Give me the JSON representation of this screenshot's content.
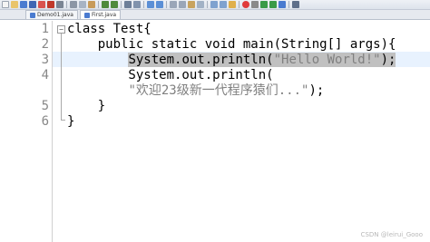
{
  "toolbar": {
    "icons": [
      "new-file-icon",
      "open-icon",
      "save-icon",
      "save-all-icon",
      "close-icon",
      "close-all-icon",
      "print-icon",
      "cut-icon",
      "copy-icon",
      "paste-icon",
      "undo-icon",
      "redo-icon",
      "find-icon",
      "replace-icon",
      "zoom-in-icon",
      "zoom-out-icon",
      "sync-icon",
      "wrap-icon",
      "indent-guide-icon",
      "show-all-icon",
      "doc-map-icon",
      "func-list-icon",
      "folder-icon",
      "record-icon",
      "stop-icon",
      "play-icon",
      "play-multiple-icon",
      "save-macro-icon",
      "spellcheck-icon"
    ]
  },
  "tabs": [
    {
      "label": "Demo01.java",
      "active": false
    },
    {
      "label": "First.java",
      "active": true
    }
  ],
  "editor": {
    "line_numbers": [
      "1",
      "2",
      "3",
      "4",
      "5",
      "6"
    ],
    "lines": {
      "l1": "class Test{",
      "l2": "    public static void main(String[] args){",
      "l3_indent": "        ",
      "l3_sel_a": "System.out.println(",
      "l3_sel_str": "\"Hello World!\"",
      "l3_sel_b": ");",
      "l4": "        System.out.println(",
      "l5_indent": "        ",
      "l5_str": "\"欢迎23级新一代程序猿们...\"",
      "l5_end": ");",
      "l6": "    }",
      "l7": "}"
    }
  },
  "watermark": "CSDN @leirui_Gooo"
}
